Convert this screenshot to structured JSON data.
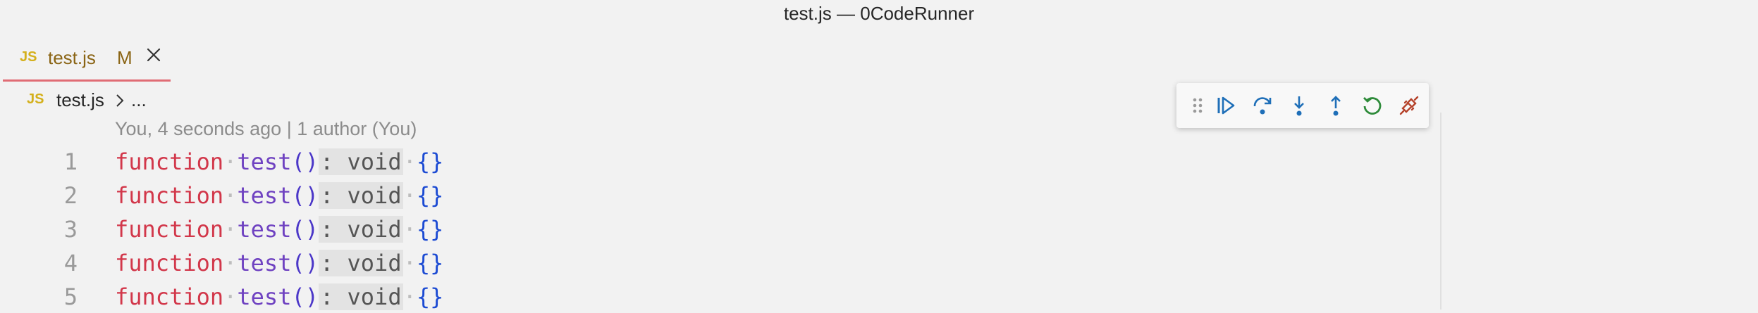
{
  "window": {
    "title": "test.js — 0CodeRunner"
  },
  "tab": {
    "lang_badge": "JS",
    "filename": "test.js",
    "status": "M"
  },
  "breadcrumb": {
    "lang_badge": "JS",
    "filename": "test.js",
    "more": "..."
  },
  "blame": {
    "text": "You, 4 seconds ago | 1 author (You)"
  },
  "lines": [
    {
      "number": "1",
      "keyword": "function",
      "name": "test",
      "parens": "()",
      "hint": ": void",
      "body": "{}"
    },
    {
      "number": "2",
      "keyword": "function",
      "name": "test",
      "parens": "()",
      "hint": ": void",
      "body": "{}"
    },
    {
      "number": "3",
      "keyword": "function",
      "name": "test",
      "parens": "()",
      "hint": ": void",
      "body": "{}"
    },
    {
      "number": "4",
      "keyword": "function",
      "name": "test",
      "parens": "()",
      "hint": ": void",
      "body": "{}"
    },
    {
      "number": "5",
      "keyword": "function",
      "name": "test",
      "parens": "()",
      "hint": ": void",
      "body": "{}"
    }
  ],
  "debug_toolbar": {
    "buttons": [
      {
        "icon": "gripper-icon",
        "color": "#9a9a9a"
      },
      {
        "icon": "continue-icon",
        "color": "#1f6fb8"
      },
      {
        "icon": "step-over-icon",
        "color": "#1f6fb8"
      },
      {
        "icon": "step-into-icon",
        "color": "#1f6fb8"
      },
      {
        "icon": "step-out-icon",
        "color": "#1f6fb8"
      },
      {
        "icon": "restart-icon",
        "color": "#2e8b3a"
      },
      {
        "icon": "disconnect-icon",
        "color": "#b5422a"
      }
    ]
  },
  "colors": {
    "keyword": "#d2374a",
    "function_name": "#6f42c1",
    "brace": "#1c4bd3",
    "tab_accent": "#e06c75",
    "js_badge": "#d4b01b"
  }
}
